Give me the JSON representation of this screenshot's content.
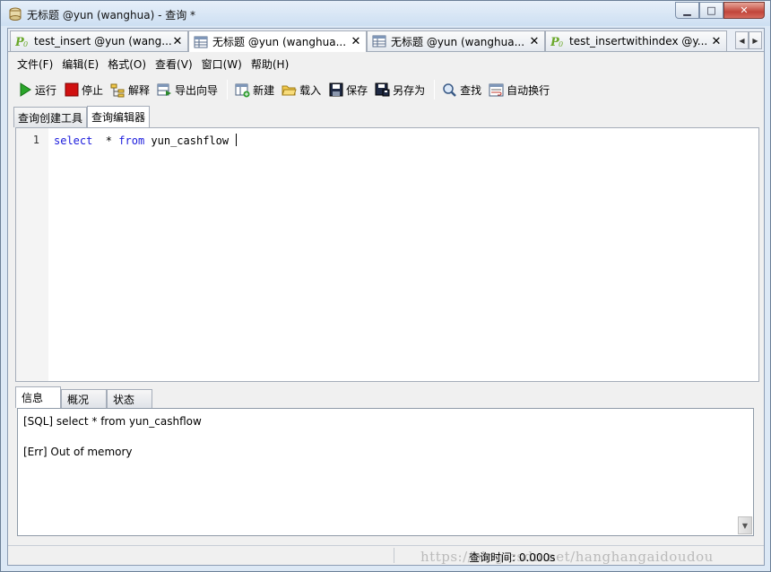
{
  "window": {
    "title": "无标题 @yun (wanghua) - 查询 *",
    "minimize_glyph": "▁",
    "maximize_glyph": "□",
    "close_glyph": "✕"
  },
  "doc_tabs": [
    {
      "label": "test_insert @yun (wang...",
      "icon": "query-p-icon",
      "close": "✕"
    },
    {
      "label": "无标题 @yun (wanghua...",
      "icon": "query-grid-icon",
      "close": "✕"
    },
    {
      "label": "无标题 @yun (wanghua...",
      "icon": "query-grid-icon",
      "close": "✕"
    },
    {
      "label": "test_insertwithindex @y...",
      "icon": "query-p-icon",
      "close": "✕"
    }
  ],
  "tab_nav": {
    "left": "◀",
    "right": "▶"
  },
  "menu": [
    {
      "label": "文件(F)"
    },
    {
      "label": "编辑(E)"
    },
    {
      "label": "格式(O)"
    },
    {
      "label": "查看(V)"
    },
    {
      "label": "窗口(W)"
    },
    {
      "label": "帮助(H)"
    }
  ],
  "toolbar": {
    "run": "运行",
    "stop": "停止",
    "explain": "解释",
    "export_wizard": "导出向导",
    "new": "新建",
    "load": "载入",
    "save": "保存",
    "save_as": "另存为",
    "find": "查找",
    "word_wrap": "自动换行"
  },
  "editor_tabs": {
    "builder": "查询创建工具",
    "editor": "查询编辑器"
  },
  "editor": {
    "line_number": "1",
    "kw_select": "select",
    "star": "  * ",
    "kw_from": "from",
    "table": " yun_cashflow "
  },
  "result_tabs": {
    "info": "信息",
    "overview": "概况",
    "status": "状态"
  },
  "messages": {
    "sql_line": "[SQL] select  * from yun_cashflow",
    "error_line": "[Err] Out of memory"
  },
  "statusbar": {
    "query_time": "查询时间: 0.000s",
    "watermark": "https://blog.csdn.net/hanghangaidoudou"
  }
}
